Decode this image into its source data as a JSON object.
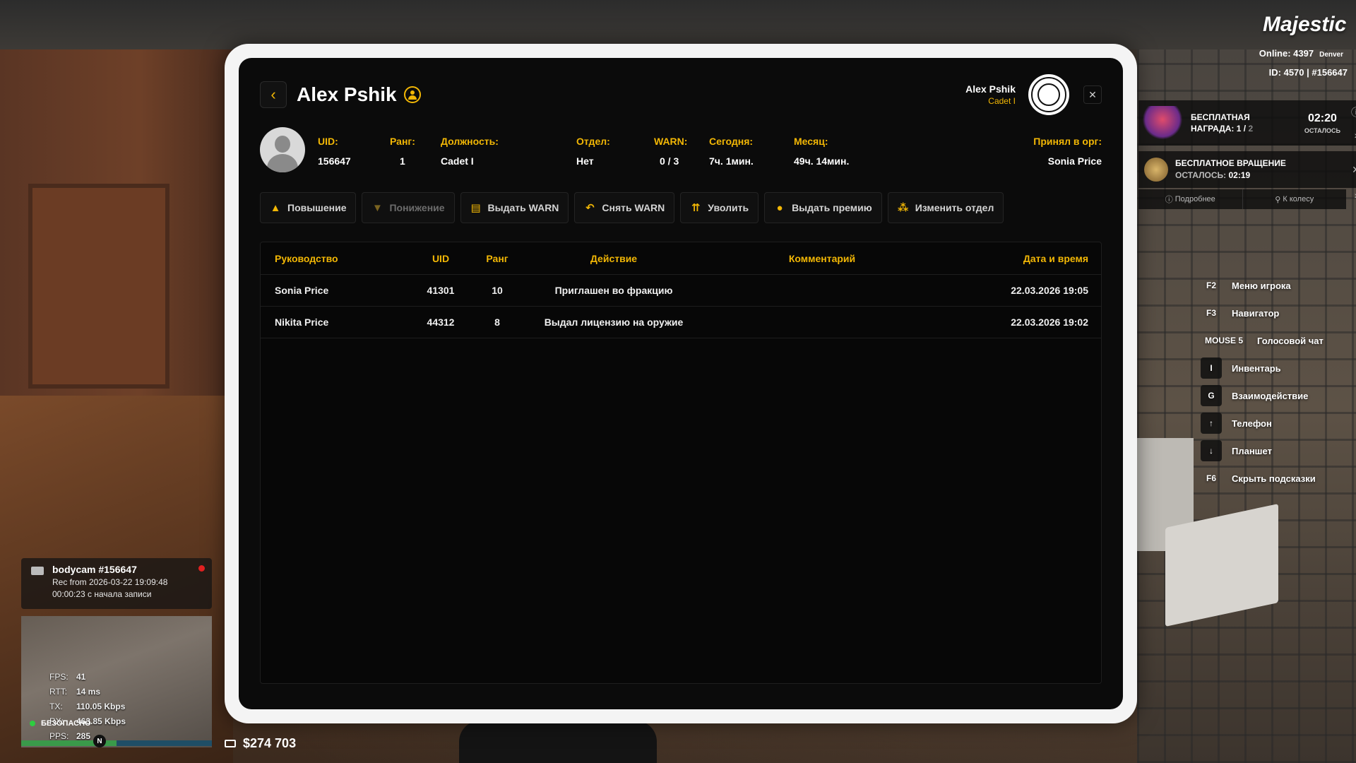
{
  "hud": {
    "logo": "Majestic",
    "online": "Online: 4397",
    "server": "Denver",
    "id_line": "ID: 4570 | #156647",
    "reward": {
      "title_line1": "БЕСПЛАТНАЯ",
      "title_line2": "НАГРАДА: 1 /",
      "total": "2",
      "timer": "02:20",
      "timer_label": "ОСТАЛОСЬ"
    },
    "spin": {
      "title": "БЕСПЛАТНОЕ ВРАЩЕНИЕ",
      "remaining_label": "ОСТАЛОСЬ:",
      "remaining": "02:19",
      "link_details": "Подробнее",
      "link_wheel": "К колесу"
    },
    "hints": [
      {
        "key": "F2",
        "label": "Меню игрока"
      },
      {
        "key": "F3",
        "label": "Навигатор"
      },
      {
        "key": "MOUSE 5",
        "label": "Голосовой чат"
      },
      {
        "key": "I",
        "label": "Инвентарь"
      },
      {
        "key": "G",
        "label": "Взаимодействие"
      },
      {
        "key": "↑",
        "label": "Телефон"
      },
      {
        "key": "↓",
        "label": "Планшет"
      },
      {
        "key": "F6",
        "label": "Скрыть подсказки"
      }
    ],
    "bodycam": {
      "title": "bodycam #156647",
      "rec": "Rec from 2026-03-22 19:09:48",
      "elapsed": "00:00:23 с начала записи"
    },
    "stats": {
      "fps_label": "FPS:",
      "fps": "41",
      "rtt_label": "RTT:",
      "rtt": "14 ms",
      "tx_label": "TX:",
      "tx": "110.05 Kbps",
      "rx_label": "RX:",
      "rx": "463.85 Kbps",
      "pps_label": "PPS:",
      "pps": "285"
    },
    "zone": "БЕЗОПАСНО",
    "compass": "N",
    "bank": "$274 703",
    "health_fraction": 0.5
  },
  "tablet": {
    "player_name": "Alex Pshik",
    "user": {
      "name": "Alex Pshik",
      "rank": "Cadet I"
    },
    "info": {
      "uid": {
        "label": "UID:",
        "value": "156647"
      },
      "rank": {
        "label": "Ранг:",
        "value": "1"
      },
      "position": {
        "label": "Должность:",
        "value": "Cadet I"
      },
      "department": {
        "label": "Отдел:",
        "value": "Нет"
      },
      "warn": {
        "label": "WARN:",
        "value": "0 / 3"
      },
      "today": {
        "label": "Сегодня:",
        "value": "7ч. 1мин."
      },
      "month": {
        "label": "Месяц:",
        "value": "49ч. 14мин."
      },
      "accepted_by": {
        "label": "Принял в орг:",
        "value": "Sonia Price"
      }
    },
    "actions": [
      {
        "label": "Повышение",
        "icon": "arrow-up-icon",
        "disabled": false
      },
      {
        "label": "Понижение",
        "icon": "arrow-down-icon",
        "disabled": true
      },
      {
        "label": "Выдать WARN",
        "icon": "warn-doc-icon",
        "disabled": false
      },
      {
        "label": "Снять WARN",
        "icon": "undo-icon",
        "disabled": false
      },
      {
        "label": "Уволить",
        "icon": "fire-icon",
        "disabled": false
      },
      {
        "label": "Выдать премию",
        "icon": "coin-icon",
        "disabled": false
      },
      {
        "label": "Изменить отдел",
        "icon": "org-icon",
        "disabled": false
      }
    ],
    "log": {
      "headers": [
        "Руководство",
        "UID",
        "Ранг",
        "Действие",
        "Комментарий",
        "Дата и время"
      ],
      "rows": [
        [
          "Sonia Price",
          "41301",
          "10",
          "Приглашен во фракцию",
          "",
          "22.03.2026 19:05"
        ],
        [
          "Nikita Price",
          "44312",
          "8",
          "Выдал лицензию на оружие",
          "",
          "22.03.2026 19:02"
        ]
      ]
    }
  },
  "colors": {
    "accent": "#f2b705",
    "background": "#0b0b0b",
    "frame": "#f4f4f4"
  }
}
